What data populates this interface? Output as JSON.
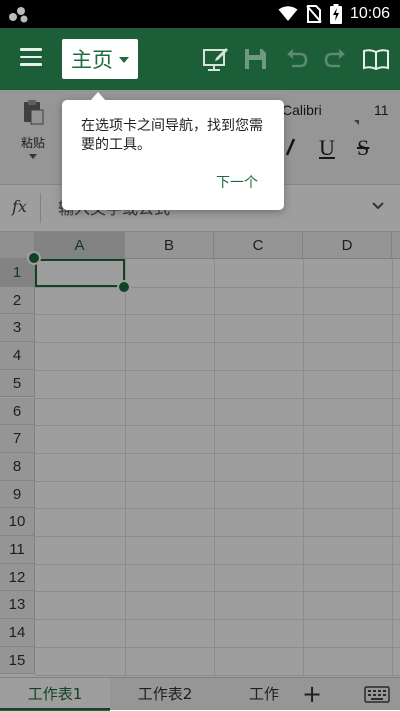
{
  "status_bar": {
    "time": "10:06"
  },
  "title_bar": {
    "active_tab": "主页",
    "accent_color": "#1b5e37"
  },
  "ribbon": {
    "paste_label": "粘贴",
    "font_name": "Calibri",
    "font_size": "11",
    "underline": "U",
    "strikethrough": "S"
  },
  "formula_bar": {
    "fx": "fx",
    "placeholder": "输入文字或公式"
  },
  "grid": {
    "columns": [
      "A",
      "B",
      "C",
      "D"
    ],
    "rows": [
      "1",
      "2",
      "3",
      "4",
      "5",
      "6",
      "7",
      "8",
      "9",
      "10",
      "11",
      "12",
      "13",
      "14",
      "15"
    ],
    "selected_cell": "A1"
  },
  "sheet_tabs": {
    "tabs": [
      "工作表1",
      "工作表2",
      "工作表"
    ],
    "active": "工作表1",
    "add": "+"
  },
  "popover": {
    "message": "在选项卡之间导航，找到您需要的工具。",
    "next_label": "下一个"
  },
  "icons": [
    "app-icon",
    "wifi-icon",
    "no-sim-icon",
    "battery-charging-icon",
    "hamburger-menu-icon",
    "draw-pen-icon",
    "save-icon",
    "undo-icon",
    "redo-icon",
    "reading-view-icon",
    "paste-icon",
    "keyboard-icon"
  ]
}
